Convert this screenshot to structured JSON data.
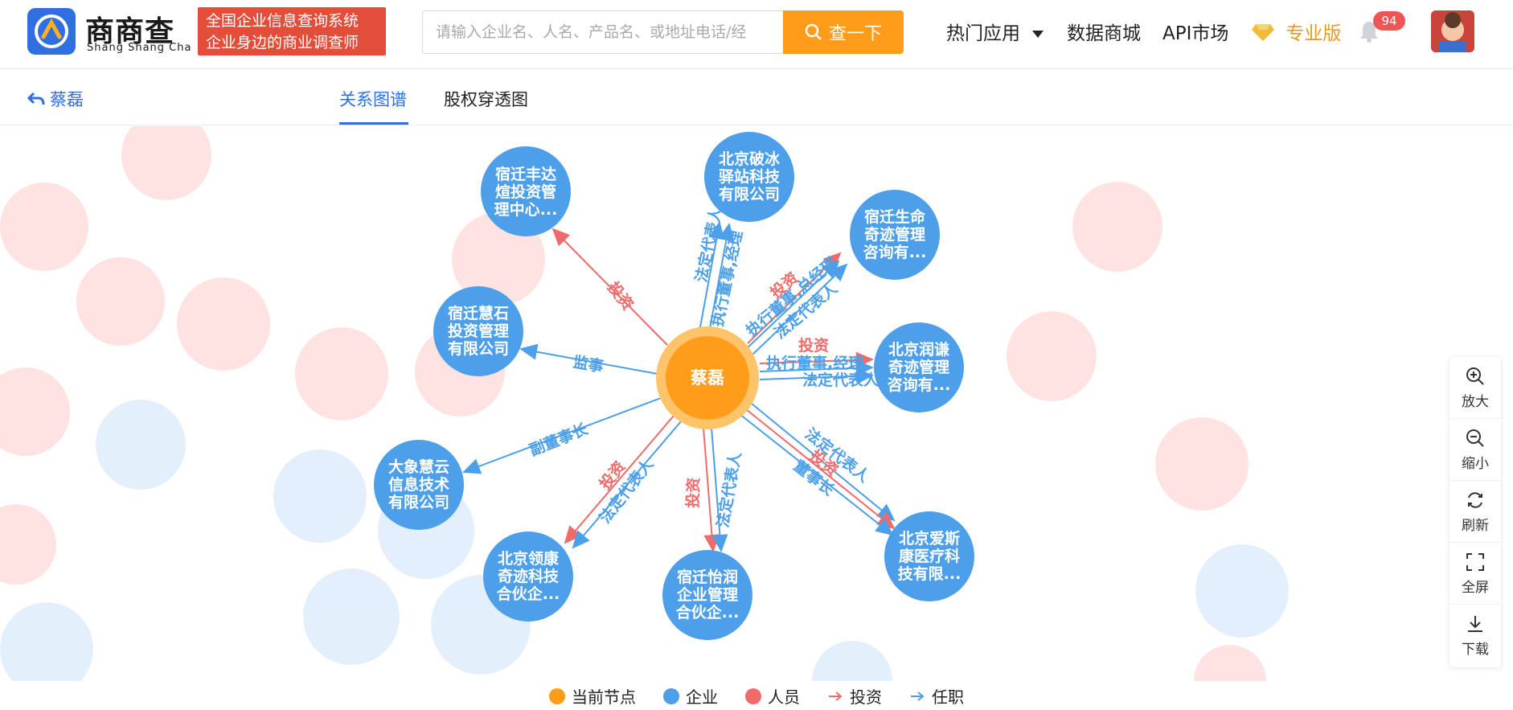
{
  "header": {
    "brand_name": "商商查",
    "brand_en": "Shang Shang Cha",
    "slogan_line1": "全国企业信息查询系统",
    "slogan_line2": "企业身边的商业调查师",
    "search_placeholder": "请输入企业名、人名、产品名、或地址电话/经",
    "search_button": "查一下",
    "nav": [
      "热门应用",
      "数据商城",
      "API市场",
      "专业版"
    ],
    "notification_count": "94"
  },
  "subheader": {
    "back_label": "蔡磊",
    "tabs": [
      "关系图谱",
      "股权穿透图"
    ]
  },
  "graph": {
    "center": "蔡磊",
    "nodes": [
      {
        "line1": "宿迁丰达",
        "line2": "煊投资管",
        "line3": "理中心..."
      },
      {
        "line1": "北京破冰",
        "line2": "驿站科技",
        "line3": "有限公司"
      },
      {
        "line1": "宿迁生命",
        "line2": "奇迹管理",
        "line3": "咨询有..."
      },
      {
        "line1": "北京润谦",
        "line2": "奇迹管理",
        "line3": "咨询有..."
      },
      {
        "line1": "北京爱斯",
        "line2": "康医疗科",
        "line3": "技有限..."
      },
      {
        "line1": "宿迁怡润",
        "line2": "企业管理",
        "line3": "合伙企..."
      },
      {
        "line1": "北京领康",
        "line2": "奇迹科技",
        "line3": "合伙企..."
      },
      {
        "line1": "大象慧云",
        "line2": "信息技术",
        "line3": "有限公司"
      },
      {
        "line1": "宿迁慧石",
        "line2": "投资管理",
        "line3": "有限公司"
      }
    ],
    "edge_labels": {
      "invest": "投资",
      "supervisor": "监事",
      "vice_chair": "副董事长",
      "legal_rep": "法定代表人",
      "exec_director": "执行董事,经理",
      "exec_gm": "执行董事,总经理",
      "chairman": "董事长"
    }
  },
  "tools": [
    "放大",
    "缩小",
    "刷新",
    "全屏",
    "下载"
  ],
  "legend": [
    {
      "label": "当前节点",
      "color": "#ff9d1a"
    },
    {
      "label": "企业",
      "color": "#4c9fe8"
    },
    {
      "label": "人员",
      "color": "#ef6b6b"
    },
    {
      "label": "投资",
      "color": "#ef6b6b"
    },
    {
      "label": "任职",
      "color": "#4c9fe8"
    }
  ]
}
